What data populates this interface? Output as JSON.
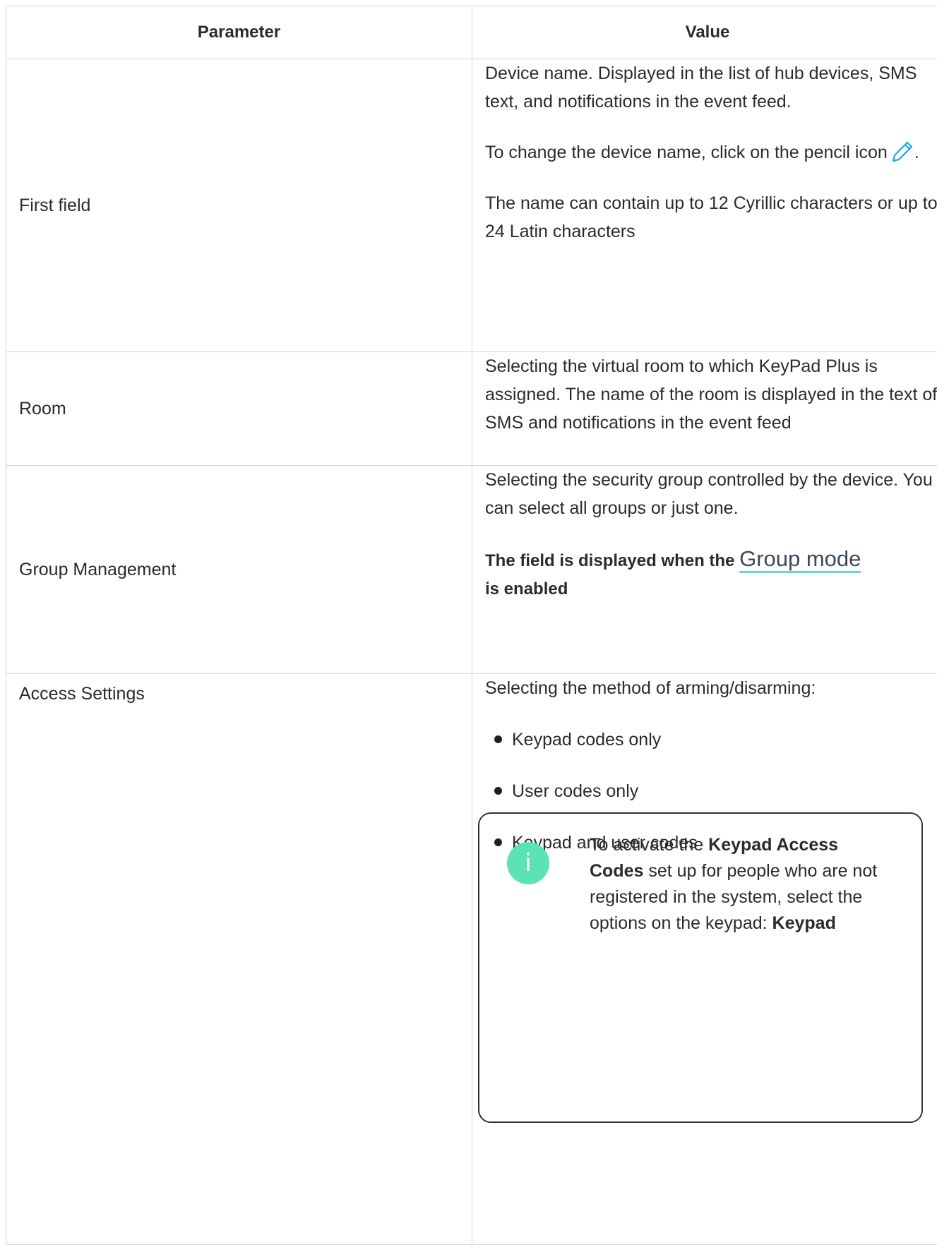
{
  "table": {
    "headers": {
      "parameter": "Parameter",
      "value": "Value"
    },
    "rows": {
      "first_field": {
        "parameter": "First field",
        "p1": "Device name. Displayed in the list of hub devices, SMS text, and notifications in the event feed.",
        "p2_text": "To change the device name, click on the pencil icon",
        "p2_end": ".",
        "p3": "The name can contain up to 12 Cyrillic characters or up to 24 Latin characters"
      },
      "room": {
        "parameter": "Room",
        "value": "Selecting the virtual room to which KeyPad Plus is assigned. The name of the room is displayed in the text of SMS and notifications in the event feed"
      },
      "group_management": {
        "parameter": "Group Management",
        "value": "Selecting the security group controlled by the device. You can select all groups or just one.",
        "note_before": "The field is displayed when the",
        "note_link": "Group mode",
        "note_after": "is enabled"
      },
      "access_settings": {
        "parameter": "Access Settings",
        "intro": "Selecting the method of arming/disarming:",
        "options": [
          "Keypad codes only",
          "User codes only",
          "Keypad and user codes"
        ]
      }
    }
  },
  "info_box": {
    "icon": "info-icon",
    "text_1": "To activate the",
    "bold_1": "Keypad Access Codes",
    "text_2": "set up for people who are not registered in the system, select the options on the keypad:",
    "bold_2": "Keypad"
  },
  "colors": {
    "accent": "#5be3b6",
    "link_underline": "#5fe0b8",
    "pencil_icon": "#1aa3e8",
    "border": "#d6d6d6",
    "text": "#2b2b2b"
  }
}
